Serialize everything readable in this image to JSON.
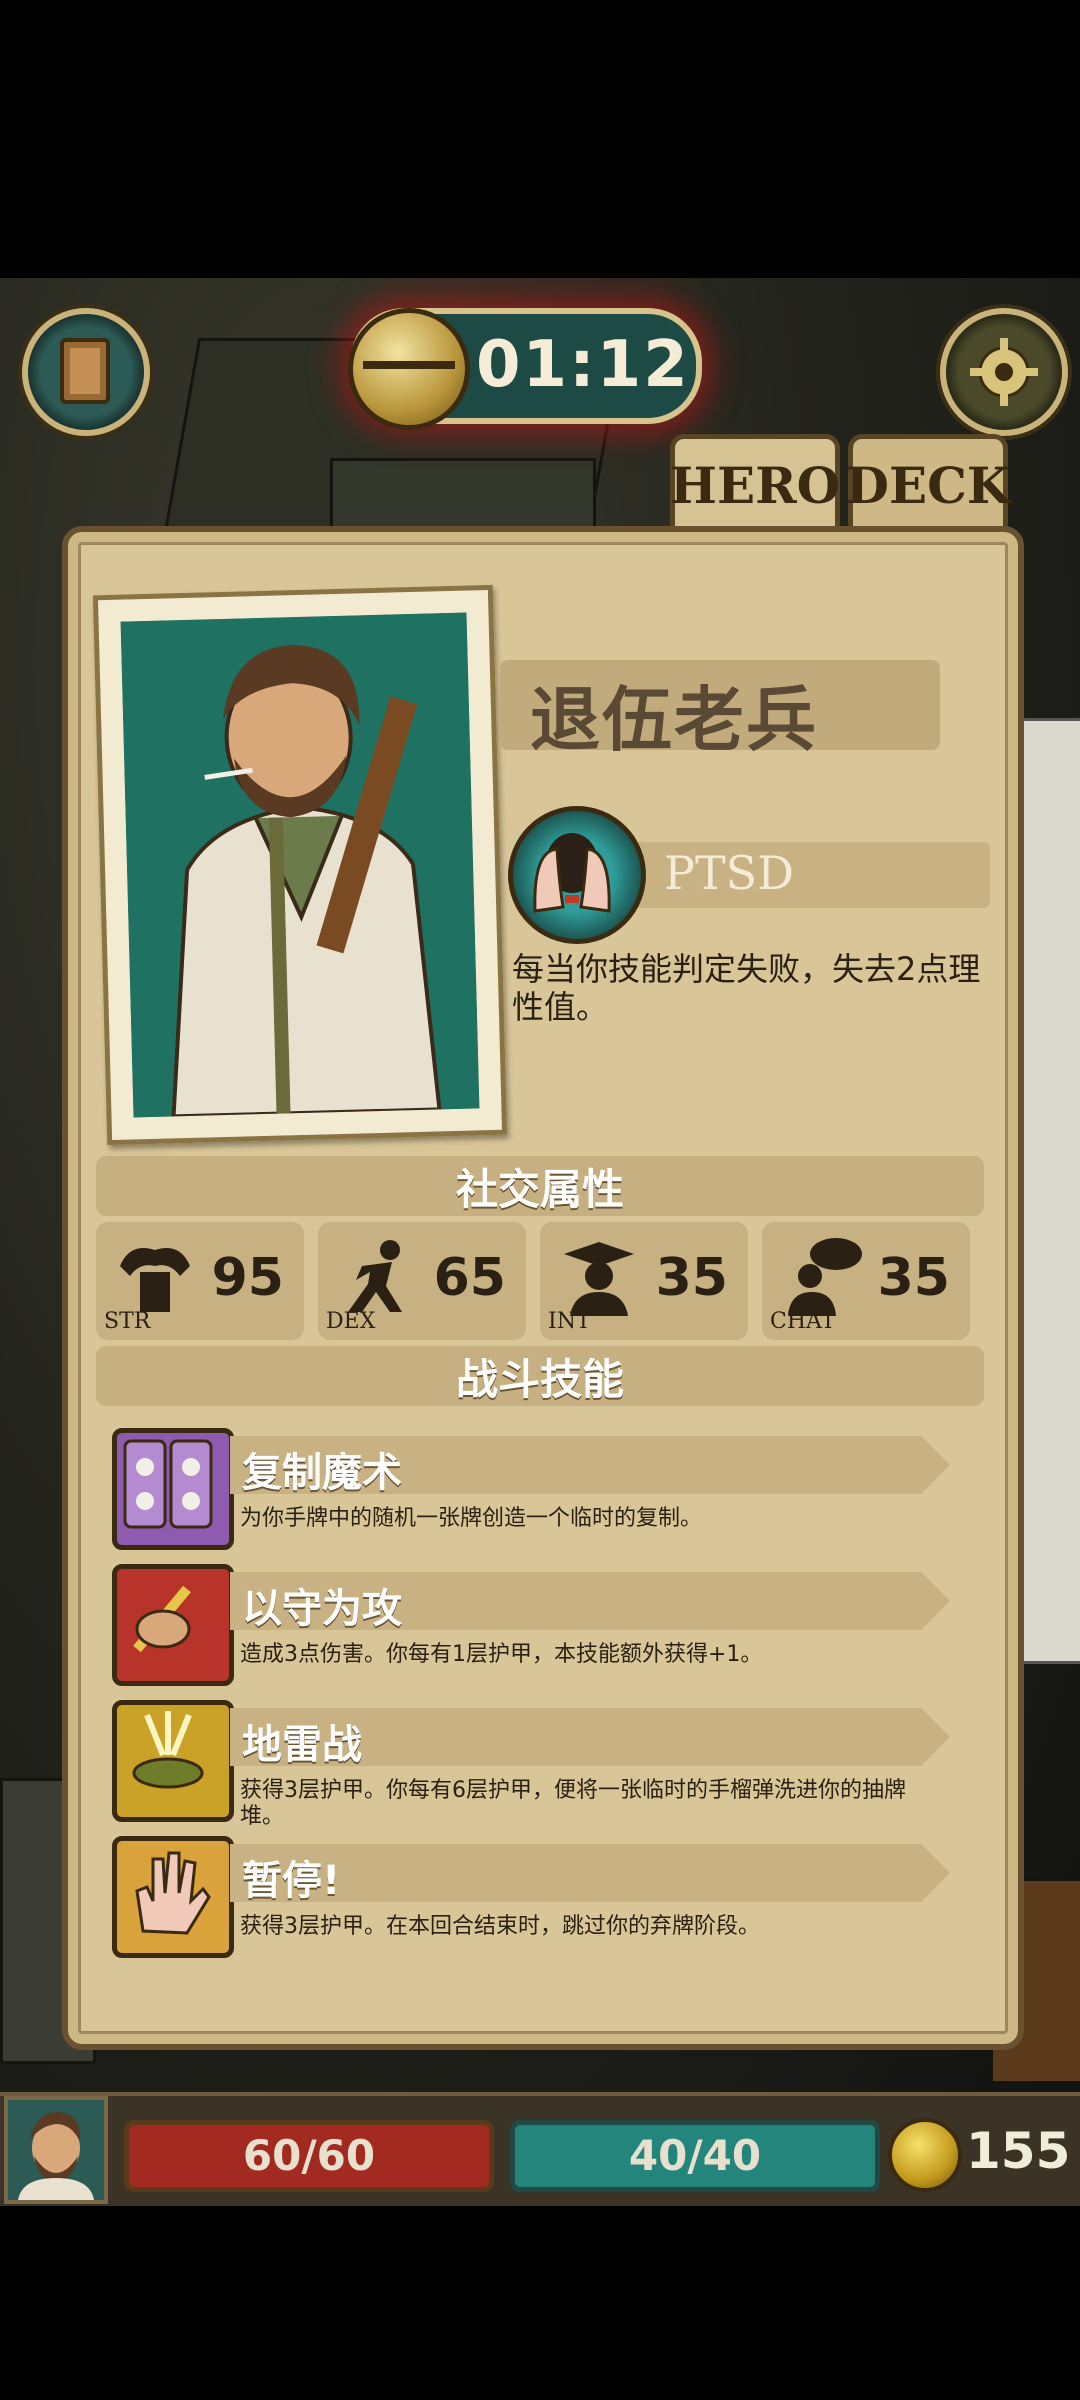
{
  "top": {
    "timer": "01:12",
    "tabs": [
      "HERO",
      "DECK"
    ]
  },
  "hero": {
    "name": "退伍老兵",
    "trait": {
      "name": "PTSD",
      "desc": "每当你技能判定失败，失去2点理性值。"
    }
  },
  "sections": {
    "social": "社交属性",
    "combat": "战斗技能"
  },
  "attributes": [
    {
      "label": "STR",
      "value": "95"
    },
    {
      "label": "DEX",
      "value": "65"
    },
    {
      "label": "INT",
      "value": "35"
    },
    {
      "label": "CHAT",
      "value": "35"
    }
  ],
  "skills": [
    {
      "name": "复制魔术",
      "desc": "为你手牌中的随机一张牌创造一个临时的复制。",
      "color": "#8e5bb0"
    },
    {
      "name": "以守为攻",
      "desc": "造成3点伤害。你每有1层护甲，本技能额外获得+1。",
      "color": "#b8342b"
    },
    {
      "name": "地雷战",
      "desc": "获得3层护甲。你每有6层护甲，便将一张临时的手榴弹洗进你的抽牌堆。",
      "color": "#c9a227"
    },
    {
      "name": "暂停!",
      "desc": "获得3层护甲。在本回合结束时，跳过你的弃牌阶段。",
      "color": "#d9a23a"
    }
  ],
  "status": {
    "hp": "60/60",
    "mp": "40/40",
    "gold": "155"
  }
}
